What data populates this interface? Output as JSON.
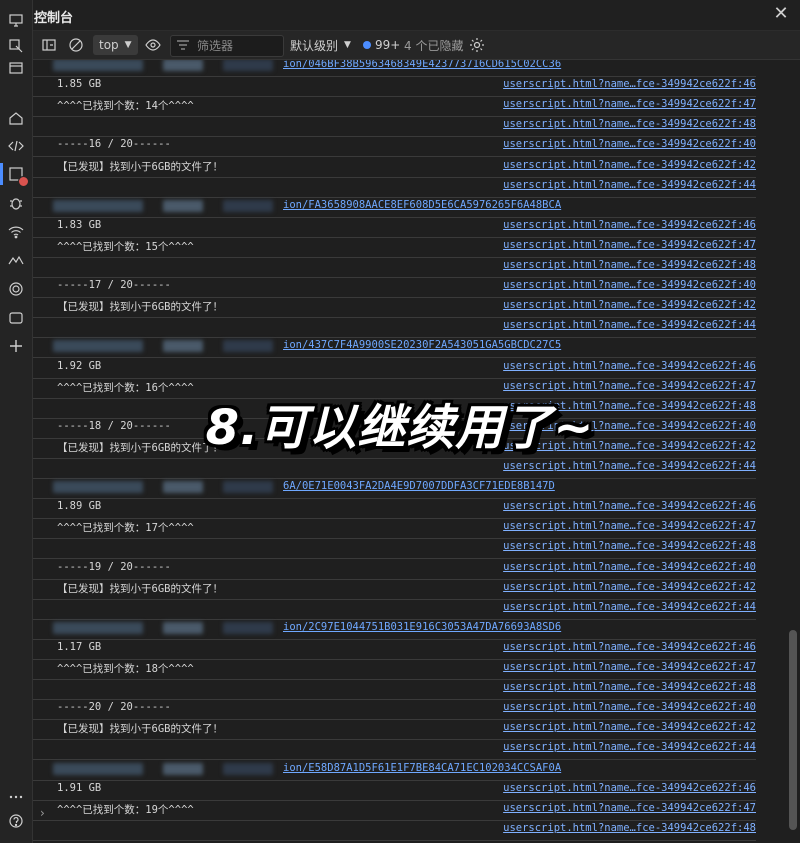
{
  "window": {
    "title": "控制台"
  },
  "toolbar": {
    "context": "top",
    "filter_placeholder": "筛选器",
    "levels": "默认级别",
    "issues_count": "99+",
    "hidden": "4 个已隐藏"
  },
  "overlay_caption": "8.可以继续用了~",
  "console_rows": [
    {
      "text": "ion/046BF38B5963468349E423773716CD615C02CC36",
      "kind": "link",
      "src": "",
      "blur": true
    },
    {
      "text": "1.85 GB",
      "src": "userscript.html?name…fce-349942ce622f:46"
    },
    {
      "text": "^^^^已找到个数：14个^^^^",
      "src": "userscript.html?name…fce-349942ce622f:47"
    },
    {
      "text": "",
      "src": "userscript.html?name…fce-349942ce622f:48"
    },
    {
      "text": "-----16 / 20------",
      "src": "userscript.html?name…fce-349942ce622f:40"
    },
    {
      "text": "【已发现】找到小于6GB的文件了！",
      "src": "userscript.html?name…fce-349942ce622f:42"
    },
    {
      "text": "",
      "src": "userscript.html?name…fce-349942ce622f:44"
    },
    {
      "text": "ion/FA3658908AACE8EF608D5E6CA5976265F6A48BCA",
      "kind": "link",
      "src": "",
      "blur": true
    },
    {
      "text": "1.83 GB",
      "src": "userscript.html?name…fce-349942ce622f:46"
    },
    {
      "text": "^^^^已找到个数：15个^^^^",
      "src": "userscript.html?name…fce-349942ce622f:47"
    },
    {
      "text": "",
      "src": "userscript.html?name…fce-349942ce622f:48"
    },
    {
      "text": "-----17 / 20------",
      "src": "userscript.html?name…fce-349942ce622f:40"
    },
    {
      "text": "【已发现】找到小于6GB的文件了！",
      "src": "userscript.html?name…fce-349942ce622f:42"
    },
    {
      "text": "",
      "src": "userscript.html?name…fce-349942ce622f:44"
    },
    {
      "text": "ion/437C7F4A9900SE20230F2A543051GA5GBCDC27C5",
      "kind": "link",
      "src": "",
      "blur": true
    },
    {
      "text": "1.92 GB",
      "src": "userscript.html?name…fce-349942ce622f:46"
    },
    {
      "text": "^^^^已找到个数：16个^^^^",
      "src": "userscript.html?name…fce-349942ce622f:47"
    },
    {
      "text": "",
      "src": "userscript.html?name…fce-349942ce622f:48"
    },
    {
      "text": "-----18 / 20------",
      "src": "userscript.html?name…fce-349942ce622f:40"
    },
    {
      "text": "【已发现】找到小于6GB的文件了！",
      "src": "userscript.html?name…fce-349942ce622f:42"
    },
    {
      "text": "",
      "src": "userscript.html?name…fce-349942ce622f:44"
    },
    {
      "text": "6A/0E71E0043FA2DA4E9D7007DDFA3CF71EDE8B147D",
      "kind": "link",
      "src": "",
      "blur": true
    },
    {
      "text": "1.89 GB",
      "src": "userscript.html?name…fce-349942ce622f:46"
    },
    {
      "text": "^^^^已找到个数：17个^^^^",
      "src": "userscript.html?name…fce-349942ce622f:47"
    },
    {
      "text": "",
      "src": "userscript.html?name…fce-349942ce622f:48"
    },
    {
      "text": "-----19 / 20------",
      "src": "userscript.html?name…fce-349942ce622f:40"
    },
    {
      "text": "【已发现】找到小于6GB的文件了！",
      "src": "userscript.html?name…fce-349942ce622f:42"
    },
    {
      "text": "",
      "src": "userscript.html?name…fce-349942ce622f:44"
    },
    {
      "text": "ion/2C97E1044751B031E916C3053A47DA76693A8SD6",
      "kind": "link",
      "src": "",
      "blur": true
    },
    {
      "text": "1.17 GB",
      "src": "userscript.html?name…fce-349942ce622f:46"
    },
    {
      "text": "^^^^已找到个数：18个^^^^",
      "src": "userscript.html?name…fce-349942ce622f:47"
    },
    {
      "text": "",
      "src": "userscript.html?name…fce-349942ce622f:48"
    },
    {
      "text": "-----20 / 20------",
      "src": "userscript.html?name…fce-349942ce622f:40"
    },
    {
      "text": "【已发现】找到小于6GB的文件了！",
      "src": "userscript.html?name…fce-349942ce622f:42"
    },
    {
      "text": "",
      "src": "userscript.html?name…fce-349942ce622f:44"
    },
    {
      "text": "ion/E58D87A1D5F61E1F7BE84CA71EC102034CCSAF0A",
      "kind": "link",
      "src": "",
      "blur": true
    },
    {
      "text": "1.91 GB",
      "src": "userscript.html?name…fce-349942ce622f:46"
    },
    {
      "text": "^^^^已找到个数：19个^^^^",
      "src": "userscript.html?name…fce-349942ce622f:47"
    },
    {
      "text": "",
      "src": "userscript.html?name…fce-349942ce622f:48"
    }
  ],
  "colors": {
    "accent": "#4c8dff",
    "error": "#d9534f",
    "link": "#7fb0ff"
  }
}
